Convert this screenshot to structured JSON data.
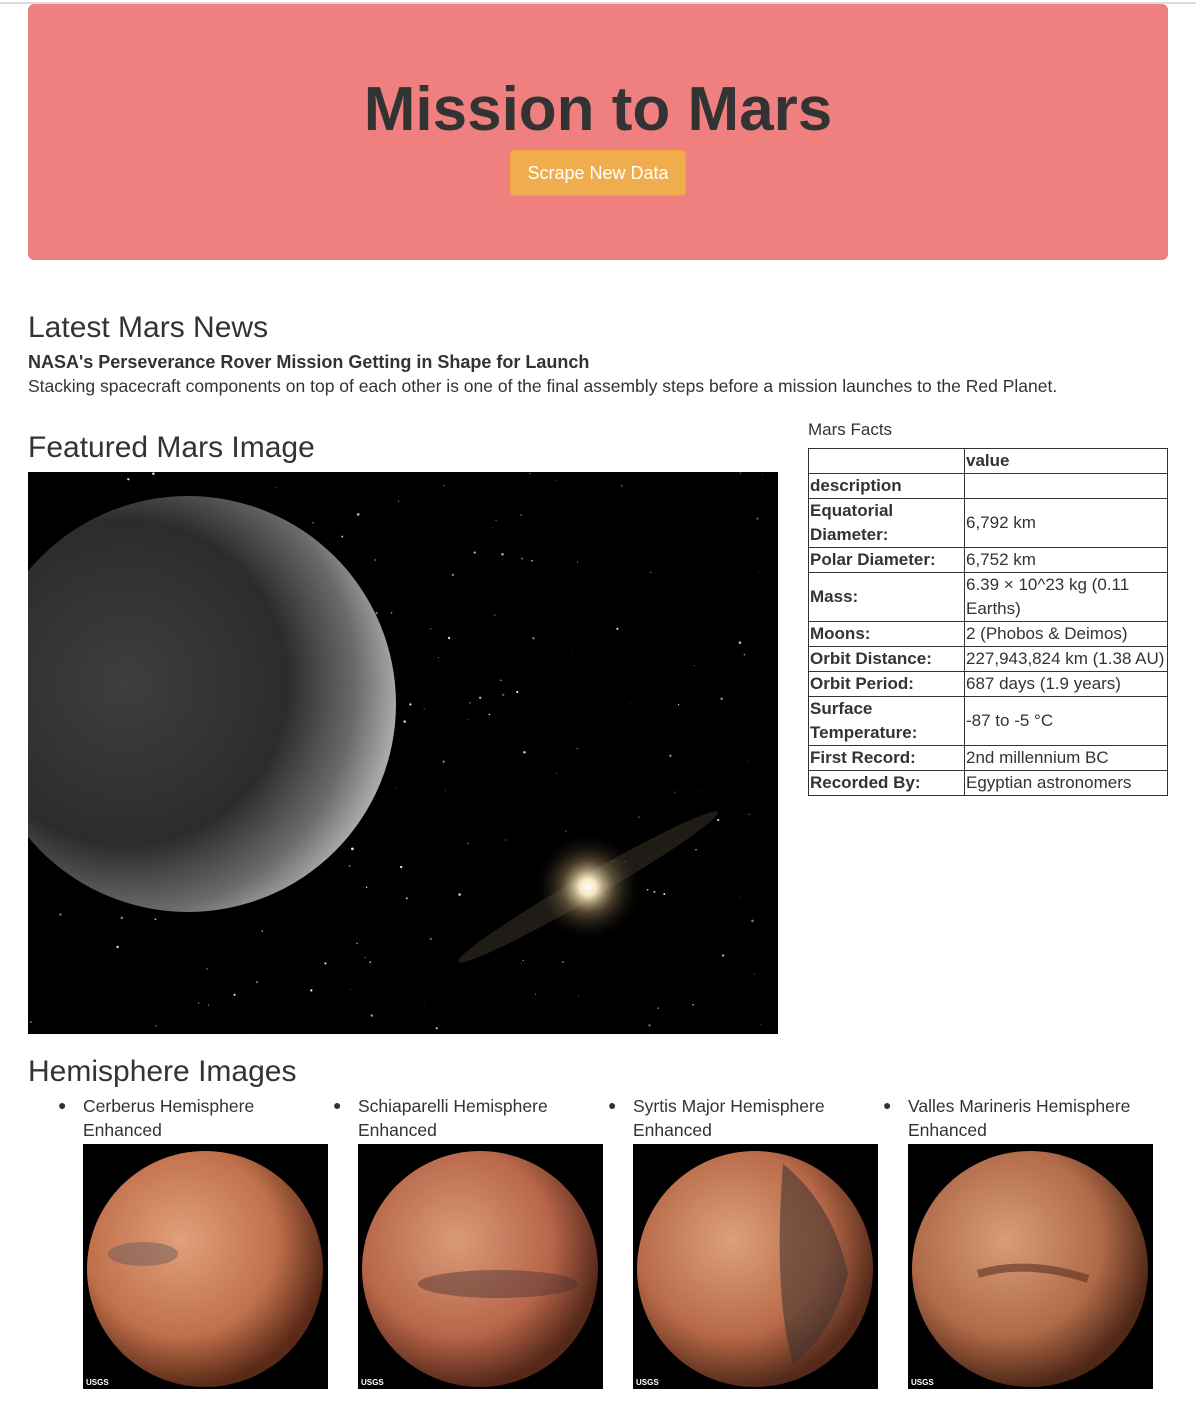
{
  "header": {
    "title": "Mission to Mars",
    "scrape_button": "Scrape New Data"
  },
  "news": {
    "heading": "Latest Mars News",
    "title": "NASA's Perseverance Rover Mission Getting in Shape for Launch",
    "paragraph": "Stacking spacecraft components on top of each other is one of the final assembly steps before a mission launches to the Red Planet."
  },
  "featured": {
    "heading": "Featured Mars Image",
    "image": "mars-featured-image",
    "colors": {
      "space": "#000000",
      "planet": "#3a3a3a",
      "star": "#f3e2b6"
    }
  },
  "facts": {
    "caption": "Mars Facts",
    "column_header": "value",
    "index_label": "description",
    "rows": [
      {
        "label": "Equatorial Diameter:",
        "value": "6,792 km"
      },
      {
        "label": "Polar Diameter:",
        "value": "6,752 km"
      },
      {
        "label": "Mass:",
        "value": "6.39 × 10^23 kg (0.11 Earths)"
      },
      {
        "label": "Moons:",
        "value": "2 (Phobos & Deimos)"
      },
      {
        "label": "Orbit Distance:",
        "value": "227,943,824 km (1.38 AU)"
      },
      {
        "label": "Orbit Period:",
        "value": "687 days (1.9 years)"
      },
      {
        "label": "Surface Temperature:",
        "value": "-87 to -5 °C"
      },
      {
        "label": "First Record:",
        "value": "2nd millennium BC"
      },
      {
        "label": "Recorded By:",
        "value": "Egyptian astronomers"
      }
    ]
  },
  "hemispheres": {
    "heading": "Hemisphere Images",
    "items": [
      {
        "title": "Cerberus Hemisphere Enhanced",
        "watermark": "USGS",
        "color": "#c0704a"
      },
      {
        "title": "Schiaparelli Hemisphere Enhanced",
        "watermark": "USGS",
        "color": "#b8664a"
      },
      {
        "title": "Syrtis Major Hemisphere Enhanced",
        "watermark": "USGS",
        "color": "#b86a48"
      },
      {
        "title": "Valles Marineris Hemisphere Enhanced",
        "watermark": "USGS",
        "color": "#b06a48"
      }
    ]
  }
}
